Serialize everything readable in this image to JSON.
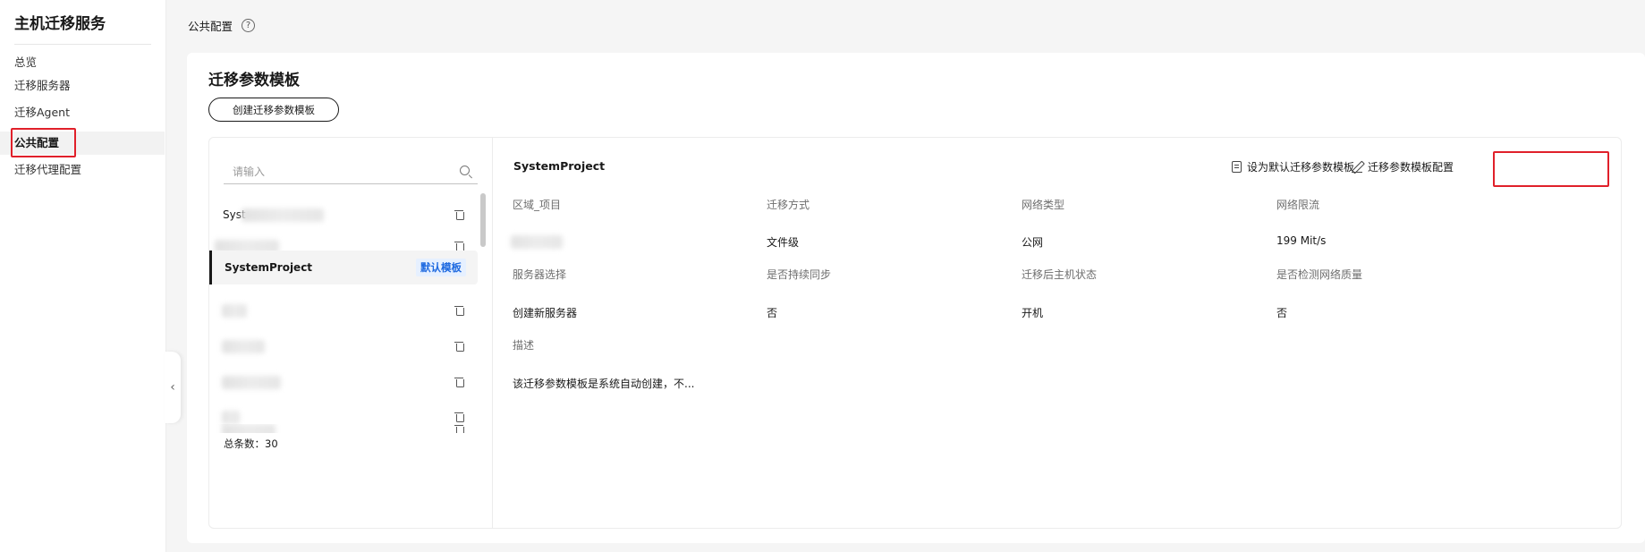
{
  "sidebar": {
    "title": "主机迁移服务",
    "items": [
      {
        "label": "总览"
      },
      {
        "label": "迁移服务器"
      },
      {
        "label": "迁移Agent"
      },
      {
        "label": "公共配置"
      },
      {
        "label": "迁移代理配置"
      }
    ]
  },
  "header": {
    "title": "公共配置",
    "help_glyph": "?"
  },
  "card": {
    "title": "迁移参数模板",
    "create_button": "创建迁移参数模板"
  },
  "list": {
    "search_placeholder": "请输入",
    "items": [
      {
        "name": "Syst",
        "blurred": true
      },
      {
        "name": "",
        "blurred": true
      },
      {
        "name": "SystemProject",
        "badge": "默认模板",
        "selected": true
      },
      {
        "name": "",
        "blurred": true
      },
      {
        "name": "",
        "blurred": true
      },
      {
        "name": "",
        "blurred": true
      },
      {
        "name": "",
        "blurred": true
      },
      {
        "name": "",
        "blurred": true
      }
    ],
    "total": "总条数：30"
  },
  "detail": {
    "name": "SystemProject",
    "actions": {
      "set_default": "设为默认迁移参数模板",
      "config": "迁移参数模板配置"
    },
    "fields": [
      {
        "label": "区域_项目",
        "value": ""
      },
      {
        "label": "迁移方式",
        "value": "文件级"
      },
      {
        "label": "网络类型",
        "value": "公网"
      },
      {
        "label": "网络限流",
        "value": "199 Mit/s"
      },
      {
        "label": "服务器选择",
        "value": "创建新服务器"
      },
      {
        "label": "是否持续同步",
        "value": "否"
      },
      {
        "label": "迁移后主机状态",
        "value": "开机"
      },
      {
        "label": "是否检测网络质量",
        "value": "否"
      }
    ],
    "description_label": "描述",
    "description_value": "该迁移参数模板是系统自动创建，不..."
  },
  "colors": {
    "highlight_red": "#e0202a",
    "badge_blue": "#1f6ae0",
    "badge_bg": "#e6f0ff"
  }
}
